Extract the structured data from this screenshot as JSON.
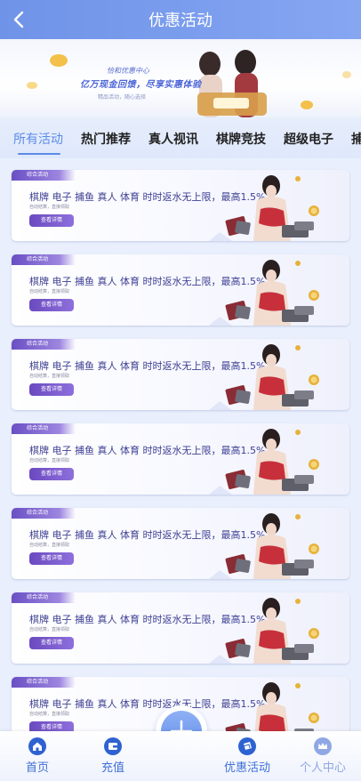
{
  "header": {
    "title": "优惠活动"
  },
  "banner": {
    "line1": "恰和优惠中心",
    "line2": "亿万现金回馈，尽享实惠体验",
    "line3": "精品活动，随心选择"
  },
  "tabs": [
    "所有活动",
    "热门推荐",
    "真人视讯",
    "棋牌竞技",
    "超级电子",
    "捕鱼"
  ],
  "cards": [
    {
      "tag": "综合活动",
      "title": "棋牌 电子 捕鱼 真人 体育 时时返水无上限，最高1.5%",
      "sub": "自动结算，直接领取",
      "button": "查看详情"
    },
    {
      "tag": "综合活动",
      "title": "棋牌 电子 捕鱼 真人 体育 时时返水无上限，最高1.5%",
      "sub": "自动结算，直接领取",
      "button": "查看详情"
    },
    {
      "tag": "综合活动",
      "title": "棋牌 电子 捕鱼 真人 体育 时时返水无上限，最高1.5%",
      "sub": "自动结算，直接领取",
      "button": "查看详情"
    },
    {
      "tag": "综合活动",
      "title": "棋牌 电子 捕鱼 真人 体育 时时返水无上限，最高1.5%",
      "sub": "自动结算，直接领取",
      "button": "查看详情"
    },
    {
      "tag": "综合活动",
      "title": "棋牌 电子 捕鱼 真人 体育 时时返水无上限，最高1.5%",
      "sub": "自动结算，直接领取",
      "button": "查看详情"
    },
    {
      "tag": "综合活动",
      "title": "棋牌 电子 捕鱼 真人 体育 时时返水无上限，最高1.5%",
      "sub": "自动结算，直接领取",
      "button": "查看详情"
    },
    {
      "tag": "综合活动",
      "title": "棋牌 电子 捕鱼 真人 体育 时时返水无上限，最高1.5%",
      "sub": "自动结算，直接领取",
      "button": "查看详情"
    }
  ],
  "nav": [
    {
      "label": "首页",
      "icon": "home-icon"
    },
    {
      "label": "充值",
      "icon": "wallet-icon"
    },
    {
      "label": "优惠活动",
      "icon": "gift-icon"
    },
    {
      "label": "个人中心",
      "icon": "crown-icon"
    }
  ],
  "colors": {
    "accent": "#5b8be8",
    "header": "#7a9cee",
    "tag": "#6a4fc4",
    "card_title": "#3e3f92"
  }
}
